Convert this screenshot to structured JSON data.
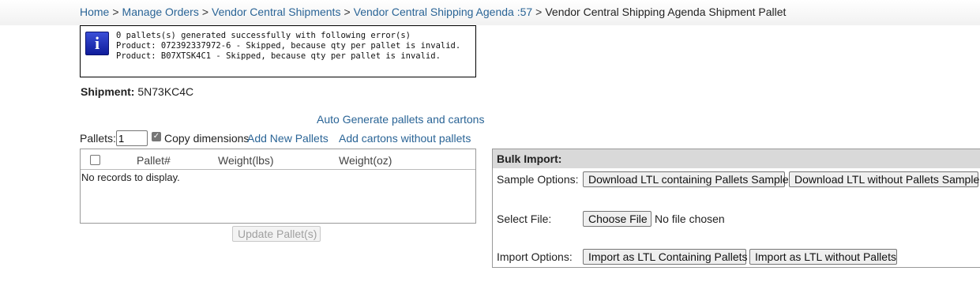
{
  "breadcrumb": {
    "home": "Home",
    "manage_orders": "Manage Orders",
    "vc_shipments": "Vendor Central Shipments",
    "vc_agenda": "Vendor Central Shipping Agenda :57",
    "current": "Vendor Central Shipping Agenda Shipment Pallet",
    "separator": ">"
  },
  "message": {
    "icon": "info-icon",
    "icon_glyph": "i",
    "line1": "0 pallets(s) generated successfully with following error(s)",
    "line2": "Product: 072392337972-6 - Skipped, because qty per pallet is invalid.",
    "line3": "Product: B07XTSK4C1 - Skipped, because qty per pallet is invalid."
  },
  "shipment": {
    "label": "Shipment:",
    "value": "5N73KC4C"
  },
  "actions": {
    "auto_generate": "Auto Generate pallets and cartons",
    "pallets_label": "Pallets:",
    "pallets_value": "1",
    "copy_dimensions_label": "Copy dimensions",
    "copy_dimensions_checked": true,
    "add_new_pallets": "Add New Pallets",
    "add_cartons_without_pallets": "Add cartons without pallets"
  },
  "grid": {
    "columns": [
      "Pallet#",
      "Weight(lbs)",
      "Weight(oz)"
    ],
    "empty_text": "No records to display.",
    "update_button": "Update Pallet(s)"
  },
  "bulk_import": {
    "title": "Bulk Import:",
    "sample_label": "Sample Options:",
    "sample_btn_1": "Download LTL containing Pallets Sample",
    "sample_btn_2": "Download LTL without Pallets Sample",
    "file_label": "Select File:",
    "choose_file": "Choose File",
    "no_file": "No file chosen",
    "import_label": "Import Options:",
    "import_btn_1": "Import as LTL Containing Pallets",
    "import_btn_2": "Import as LTL without Pallets"
  },
  "colors": {
    "link": "#2a6496",
    "header_gray": "#d9d9d9"
  }
}
